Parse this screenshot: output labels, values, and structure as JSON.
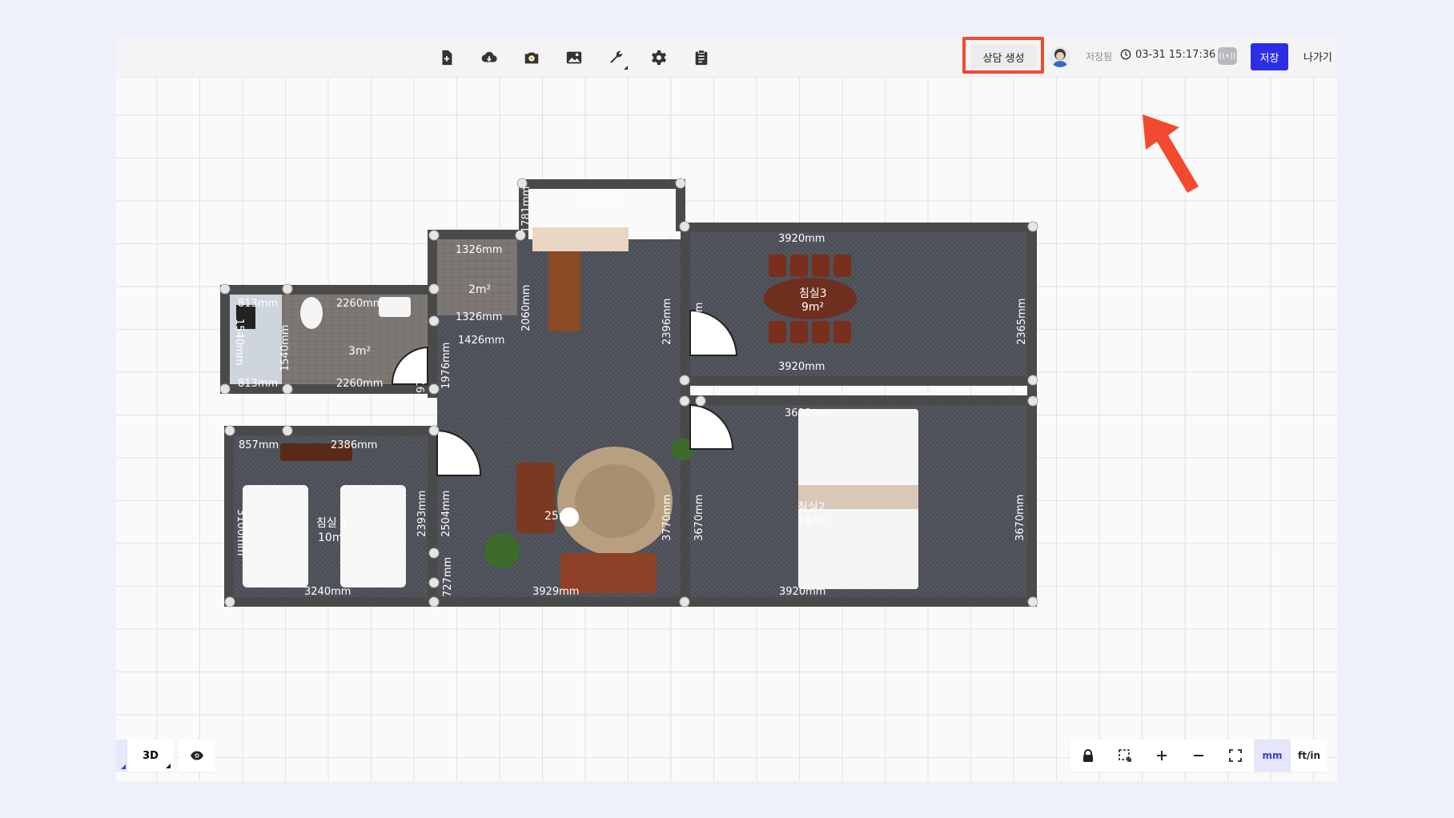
{
  "toolbar": {
    "icons": [
      "new-file-icon",
      "cloud-download-icon",
      "camera-icon",
      "image-icon",
      "wrench-icon",
      "gear-icon",
      "clipboard-icon"
    ],
    "consult_label": "상담 생성",
    "saved_label": "저장됨",
    "timestamp": "03-31 15:17:36",
    "save_label": "저장",
    "exit_label": "나가기"
  },
  "floorplan": {
    "rooms": [
      {
        "label": "2m²"
      },
      {
        "label": "3m²"
      },
      {
        "label": "침실3"
      },
      {
        "label": "9m²"
      },
      {
        "label": "침실 1"
      },
      {
        "label": "10m²"
      },
      {
        "label": "25m²"
      },
      {
        "label": "침실2"
      },
      {
        "label": "14m²"
      }
    ],
    "dimensions": [
      "2500mm",
      "1781mm",
      "1326mm",
      "1326mm",
      "1426mm",
      "2060mm",
      "3920mm",
      "3920mm",
      "2365mm",
      "2396mm",
      "2365mm",
      "813mm",
      "813mm",
      "2260mm",
      "2260mm",
      "1540mm",
      "1540mm",
      "976mm",
      "1976mm",
      "857mm",
      "2386mm",
      "3100mm",
      "3240mm",
      "2393mm",
      "2504mm",
      "727mm",
      "3929mm",
      "3770mm",
      "3690mm",
      "3670mm",
      "3670mm",
      "3920mm"
    ]
  },
  "bottom_left": {
    "view_3d_label": "3D"
  },
  "bottom_right": {
    "unit_mm": "mm",
    "unit_ftin": "ft/in"
  },
  "colors": {
    "accent": "#2c2ee6",
    "highlight": "#f24a2e",
    "wall": "#4a4a4a",
    "floor": "#4b4e55"
  }
}
